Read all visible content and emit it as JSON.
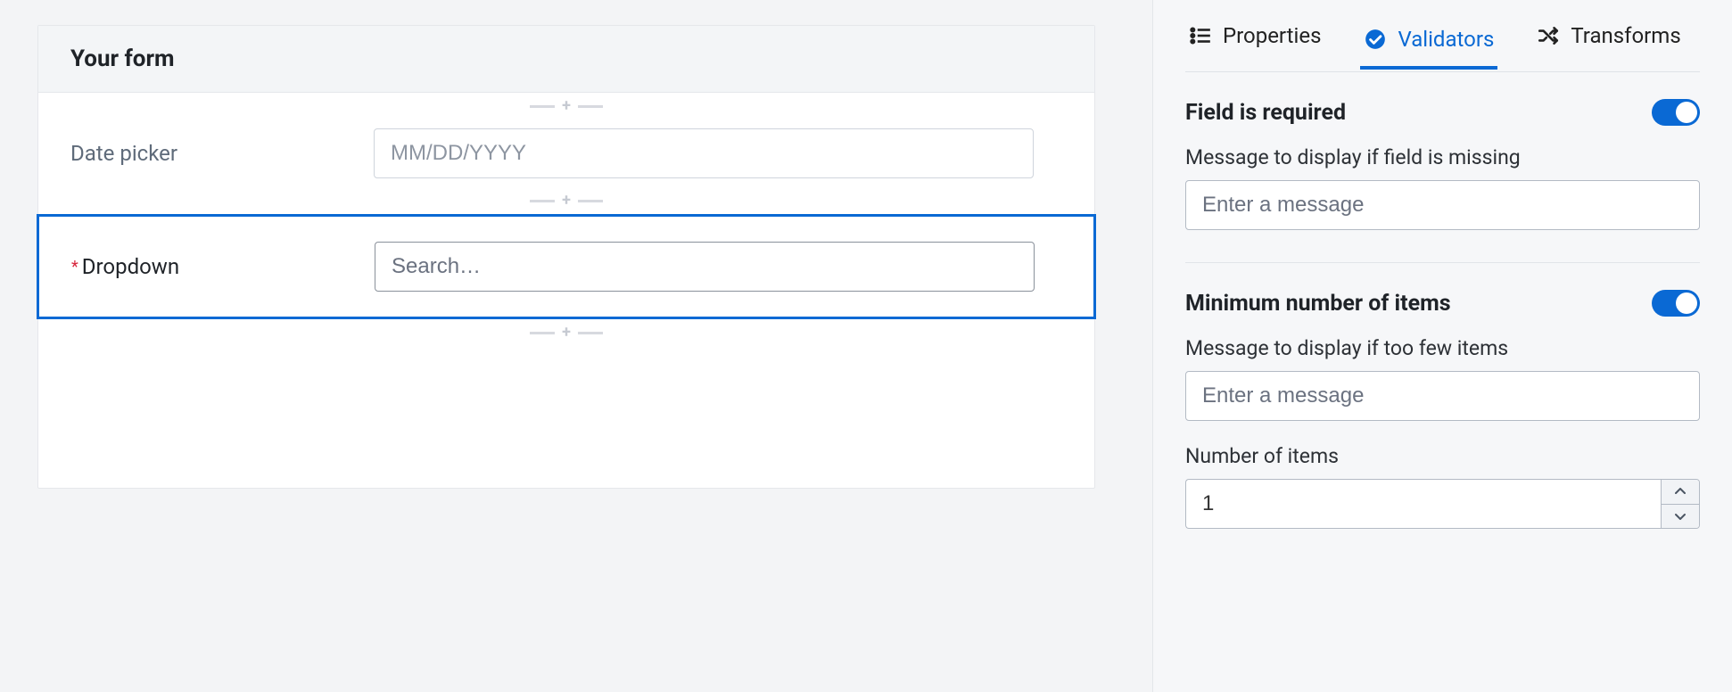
{
  "canvas": {
    "title": "Your form",
    "fields": {
      "date": {
        "label": "Date picker",
        "placeholder": "MM/DD/YYYY"
      },
      "dropdown": {
        "label": "Dropdown",
        "placeholder": "Search…"
      }
    }
  },
  "tabs": {
    "properties": "Properties",
    "validators": "Validators",
    "transforms": "Transforms"
  },
  "sections": {
    "required": {
      "title": "Field is required",
      "msg_label": "Message to display if field is missing",
      "msg_placeholder": "Enter a message"
    },
    "min_items": {
      "title": "Minimum number of items",
      "msg_label": "Message to display if too few items",
      "msg_placeholder": "Enter a message",
      "num_label": "Number of items",
      "num_value": "1"
    }
  }
}
